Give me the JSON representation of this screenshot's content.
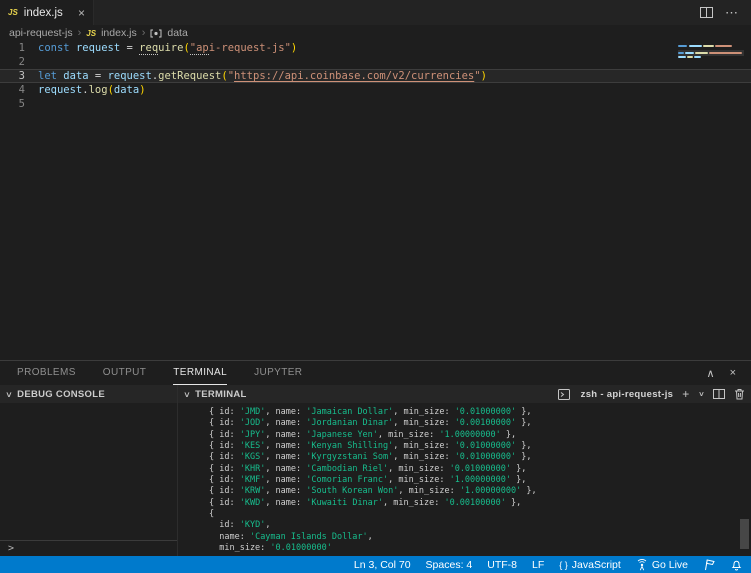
{
  "icons": {
    "close": "×",
    "chevron_up": "∧",
    "chevron_down": "∨",
    "plus": "+",
    "more": "⋯",
    "separator": "›",
    "prompt": ">",
    "braces": "{ }"
  },
  "tabbar": {
    "tab": {
      "icon_label": "JS",
      "label": "index.js"
    }
  },
  "breadcrumb": {
    "project": "api-request-js",
    "file_icon": "JS",
    "file": "index.js",
    "symbol": "data"
  },
  "editor": {
    "current_line": 3,
    "lines": [
      {
        "num": "1",
        "tokens": [
          {
            "t": "const",
            "c": "kw"
          },
          {
            "t": " ",
            "c": "pun"
          },
          {
            "t": "request",
            "c": "var"
          },
          {
            "t": " = ",
            "c": "pun"
          },
          {
            "t": "req",
            "c": "fn",
            "d": 1
          },
          {
            "t": "uire",
            "c": "fn"
          },
          {
            "t": "(",
            "c": "par"
          },
          {
            "t": "\"ap",
            "c": "str",
            "d": 1
          },
          {
            "t": "i-request-js\"",
            "c": "str"
          },
          {
            "t": ")",
            "c": "par"
          }
        ]
      },
      {
        "num": "2",
        "tokens": []
      },
      {
        "num": "3",
        "tokens": [
          {
            "t": "let",
            "c": "kw"
          },
          {
            "t": " ",
            "c": "pun"
          },
          {
            "t": "data",
            "c": "var"
          },
          {
            "t": " = ",
            "c": "pun"
          },
          {
            "t": "request",
            "c": "var"
          },
          {
            "t": ".",
            "c": "pun"
          },
          {
            "t": "getRequest",
            "c": "fn"
          },
          {
            "t": "(",
            "c": "par"
          },
          {
            "t": "\"",
            "c": "str"
          },
          {
            "t": "https://api.coinbase.com/v2/currencies",
            "c": "str",
            "l": 1
          },
          {
            "t": "\"",
            "c": "str"
          },
          {
            "t": ")",
            "c": "par"
          }
        ]
      },
      {
        "num": "4",
        "tokens": [
          {
            "t": "request",
            "c": "var"
          },
          {
            "t": ".",
            "c": "pun"
          },
          {
            "t": "log",
            "c": "fn"
          },
          {
            "t": "(",
            "c": "par"
          },
          {
            "t": "data",
            "c": "var"
          },
          {
            "t": ")",
            "c": "par"
          }
        ]
      },
      {
        "num": "5",
        "tokens": []
      }
    ]
  },
  "panel": {
    "tabs": [
      {
        "label": "PROBLEMS"
      },
      {
        "label": "OUTPUT"
      },
      {
        "label": "TERMINAL"
      },
      {
        "label": "JUPYTER"
      }
    ],
    "active_tab": "TERMINAL",
    "debug_console": {
      "title": "DEBUG CONSOLE"
    },
    "terminal": {
      "title": "TERMINAL",
      "session": "zsh - api-request-js",
      "lines": [
        "{ id: 'JMD', name: 'Jamaican Dollar', min_size: '0.01000000' },",
        "{ id: 'JOD', name: 'Jordanian Dinar', min_size: '0.00100000' },",
        "{ id: 'JPY', name: 'Japanese Yen', min_size: '1.00000000' },",
        "{ id: 'KES', name: 'Kenyan Shilling', min_size: '0.01000000' },",
        "{ id: 'KGS', name: 'Kyrgyzstani Som', min_size: '0.01000000' },",
        "{ id: 'KHR', name: 'Cambodian Riel', min_size: '0.01000000' },",
        "{ id: 'KMF', name: 'Comorian Franc', min_size: '1.00000000' },",
        "{ id: 'KRW', name: 'South Korean Won', min_size: '1.00000000' },",
        "{ id: 'KWD', name: 'Kuwaiti Dinar', min_size: '0.00100000' },",
        "{",
        "  id: 'KYD',",
        "  name: 'Cayman Islands Dollar',",
        "  min_size: '0.01000000'"
      ]
    }
  },
  "statusbar": {
    "cursor": "Ln 3, Col 70",
    "indent": "Spaces: 4",
    "encoding": "UTF-8",
    "eol": "LF",
    "language": "JavaScript",
    "golive": "Go Live"
  },
  "colors": {
    "statusbar_accent": "#007acc",
    "keyword": "#569cd6",
    "variable": "#9cdcfe",
    "function": "#dcdcaa",
    "string": "#ce9178",
    "bracket": "#ffd700",
    "terminal_string_green": "#17bd8d",
    "editor_background": "#1e1e1e"
  }
}
